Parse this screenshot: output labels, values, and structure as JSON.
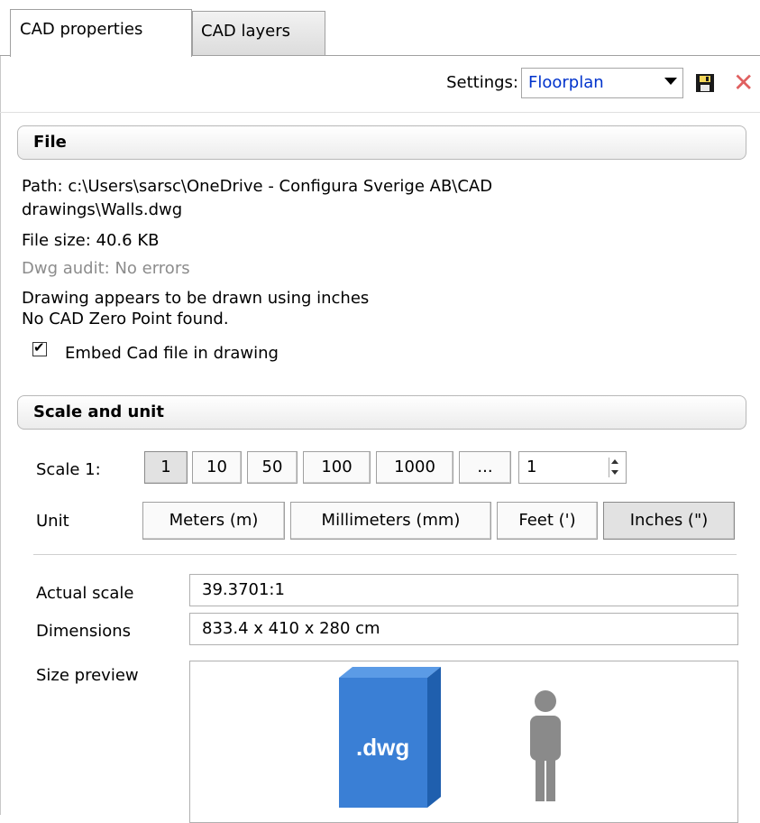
{
  "tabs": [
    {
      "label": "CAD properties",
      "active": true
    },
    {
      "label": "CAD layers",
      "active": false
    }
  ],
  "settings": {
    "label": "Settings:",
    "selected": "Floorplan",
    "save_icon": "save-icon",
    "close_icon": "close-icon",
    "close_color": "#e06060",
    "accent": "#0033cc"
  },
  "file_section": {
    "title": "File",
    "path_line1": "Path: c:\\Users\\sarsc\\OneDrive - Configura Sverige AB\\CAD",
    "path_line2": " drawings\\Walls.dwg",
    "file_size": "File size: 40.6 KB",
    "dwg_audit": "Dwg audit: No errors",
    "units_note": "Drawing appears to be drawn using inches",
    "zero_point": "No CAD Zero Point found.",
    "embed_label": "Embed Cad file in drawing",
    "embed_checked": true
  },
  "scale_section": {
    "title": "Scale and unit",
    "scale_label": "Scale 1:",
    "scale_buttons": [
      "1",
      "10",
      "50",
      "100",
      "1000",
      "..."
    ],
    "scale_selected": "1",
    "scale_value": "1",
    "unit_label": "Unit",
    "unit_buttons": [
      "Meters (m)",
      "Millimeters (mm)",
      "Feet (')",
      "Inches (\")"
    ],
    "unit_selected": "Inches (\")",
    "actual_scale_label": "Actual scale",
    "actual_scale_value": "39.3701:1",
    "dimensions_label": "Dimensions",
    "dimensions_value": "833.4 x 410 x 280 cm",
    "size_preview_label": "Size preview",
    "preview_cube_text": ".dwg",
    "cube_color": "#3a7fd5",
    "person_color": "#8a8a8a"
  }
}
